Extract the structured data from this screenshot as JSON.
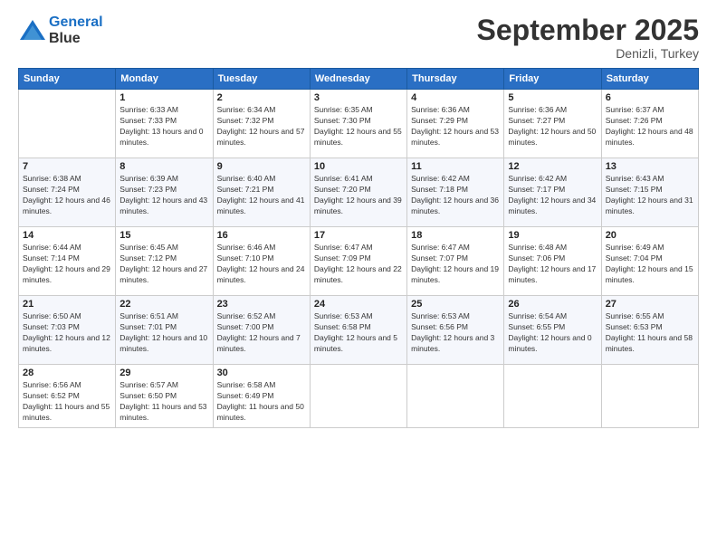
{
  "header": {
    "logo_line1": "General",
    "logo_line2": "Blue",
    "month_title": "September 2025",
    "location": "Denizli, Turkey"
  },
  "weekdays": [
    "Sunday",
    "Monday",
    "Tuesday",
    "Wednesday",
    "Thursday",
    "Friday",
    "Saturday"
  ],
  "rows": [
    [
      {
        "day": "",
        "sunrise": "",
        "sunset": "",
        "daylight": ""
      },
      {
        "day": "1",
        "sunrise": "Sunrise: 6:33 AM",
        "sunset": "Sunset: 7:33 PM",
        "daylight": "Daylight: 13 hours and 0 minutes."
      },
      {
        "day": "2",
        "sunrise": "Sunrise: 6:34 AM",
        "sunset": "Sunset: 7:32 PM",
        "daylight": "Daylight: 12 hours and 57 minutes."
      },
      {
        "day": "3",
        "sunrise": "Sunrise: 6:35 AM",
        "sunset": "Sunset: 7:30 PM",
        "daylight": "Daylight: 12 hours and 55 minutes."
      },
      {
        "day": "4",
        "sunrise": "Sunrise: 6:36 AM",
        "sunset": "Sunset: 7:29 PM",
        "daylight": "Daylight: 12 hours and 53 minutes."
      },
      {
        "day": "5",
        "sunrise": "Sunrise: 6:36 AM",
        "sunset": "Sunset: 7:27 PM",
        "daylight": "Daylight: 12 hours and 50 minutes."
      },
      {
        "day": "6",
        "sunrise": "Sunrise: 6:37 AM",
        "sunset": "Sunset: 7:26 PM",
        "daylight": "Daylight: 12 hours and 48 minutes."
      }
    ],
    [
      {
        "day": "7",
        "sunrise": "Sunrise: 6:38 AM",
        "sunset": "Sunset: 7:24 PM",
        "daylight": "Daylight: 12 hours and 46 minutes."
      },
      {
        "day": "8",
        "sunrise": "Sunrise: 6:39 AM",
        "sunset": "Sunset: 7:23 PM",
        "daylight": "Daylight: 12 hours and 43 minutes."
      },
      {
        "day": "9",
        "sunrise": "Sunrise: 6:40 AM",
        "sunset": "Sunset: 7:21 PM",
        "daylight": "Daylight: 12 hours and 41 minutes."
      },
      {
        "day": "10",
        "sunrise": "Sunrise: 6:41 AM",
        "sunset": "Sunset: 7:20 PM",
        "daylight": "Daylight: 12 hours and 39 minutes."
      },
      {
        "day": "11",
        "sunrise": "Sunrise: 6:42 AM",
        "sunset": "Sunset: 7:18 PM",
        "daylight": "Daylight: 12 hours and 36 minutes."
      },
      {
        "day": "12",
        "sunrise": "Sunrise: 6:42 AM",
        "sunset": "Sunset: 7:17 PM",
        "daylight": "Daylight: 12 hours and 34 minutes."
      },
      {
        "day": "13",
        "sunrise": "Sunrise: 6:43 AM",
        "sunset": "Sunset: 7:15 PM",
        "daylight": "Daylight: 12 hours and 31 minutes."
      }
    ],
    [
      {
        "day": "14",
        "sunrise": "Sunrise: 6:44 AM",
        "sunset": "Sunset: 7:14 PM",
        "daylight": "Daylight: 12 hours and 29 minutes."
      },
      {
        "day": "15",
        "sunrise": "Sunrise: 6:45 AM",
        "sunset": "Sunset: 7:12 PM",
        "daylight": "Daylight: 12 hours and 27 minutes."
      },
      {
        "day": "16",
        "sunrise": "Sunrise: 6:46 AM",
        "sunset": "Sunset: 7:10 PM",
        "daylight": "Daylight: 12 hours and 24 minutes."
      },
      {
        "day": "17",
        "sunrise": "Sunrise: 6:47 AM",
        "sunset": "Sunset: 7:09 PM",
        "daylight": "Daylight: 12 hours and 22 minutes."
      },
      {
        "day": "18",
        "sunrise": "Sunrise: 6:47 AM",
        "sunset": "Sunset: 7:07 PM",
        "daylight": "Daylight: 12 hours and 19 minutes."
      },
      {
        "day": "19",
        "sunrise": "Sunrise: 6:48 AM",
        "sunset": "Sunset: 7:06 PM",
        "daylight": "Daylight: 12 hours and 17 minutes."
      },
      {
        "day": "20",
        "sunrise": "Sunrise: 6:49 AM",
        "sunset": "Sunset: 7:04 PM",
        "daylight": "Daylight: 12 hours and 15 minutes."
      }
    ],
    [
      {
        "day": "21",
        "sunrise": "Sunrise: 6:50 AM",
        "sunset": "Sunset: 7:03 PM",
        "daylight": "Daylight: 12 hours and 12 minutes."
      },
      {
        "day": "22",
        "sunrise": "Sunrise: 6:51 AM",
        "sunset": "Sunset: 7:01 PM",
        "daylight": "Daylight: 12 hours and 10 minutes."
      },
      {
        "day": "23",
        "sunrise": "Sunrise: 6:52 AM",
        "sunset": "Sunset: 7:00 PM",
        "daylight": "Daylight: 12 hours and 7 minutes."
      },
      {
        "day": "24",
        "sunrise": "Sunrise: 6:53 AM",
        "sunset": "Sunset: 6:58 PM",
        "daylight": "Daylight: 12 hours and 5 minutes."
      },
      {
        "day": "25",
        "sunrise": "Sunrise: 6:53 AM",
        "sunset": "Sunset: 6:56 PM",
        "daylight": "Daylight: 12 hours and 3 minutes."
      },
      {
        "day": "26",
        "sunrise": "Sunrise: 6:54 AM",
        "sunset": "Sunset: 6:55 PM",
        "daylight": "Daylight: 12 hours and 0 minutes."
      },
      {
        "day": "27",
        "sunrise": "Sunrise: 6:55 AM",
        "sunset": "Sunset: 6:53 PM",
        "daylight": "Daylight: 11 hours and 58 minutes."
      }
    ],
    [
      {
        "day": "28",
        "sunrise": "Sunrise: 6:56 AM",
        "sunset": "Sunset: 6:52 PM",
        "daylight": "Daylight: 11 hours and 55 minutes."
      },
      {
        "day": "29",
        "sunrise": "Sunrise: 6:57 AM",
        "sunset": "Sunset: 6:50 PM",
        "daylight": "Daylight: 11 hours and 53 minutes."
      },
      {
        "day": "30",
        "sunrise": "Sunrise: 6:58 AM",
        "sunset": "Sunset: 6:49 PM",
        "daylight": "Daylight: 11 hours and 50 minutes."
      },
      {
        "day": "",
        "sunrise": "",
        "sunset": "",
        "daylight": ""
      },
      {
        "day": "",
        "sunrise": "",
        "sunset": "",
        "daylight": ""
      },
      {
        "day": "",
        "sunrise": "",
        "sunset": "",
        "daylight": ""
      },
      {
        "day": "",
        "sunrise": "",
        "sunset": "",
        "daylight": ""
      }
    ]
  ]
}
